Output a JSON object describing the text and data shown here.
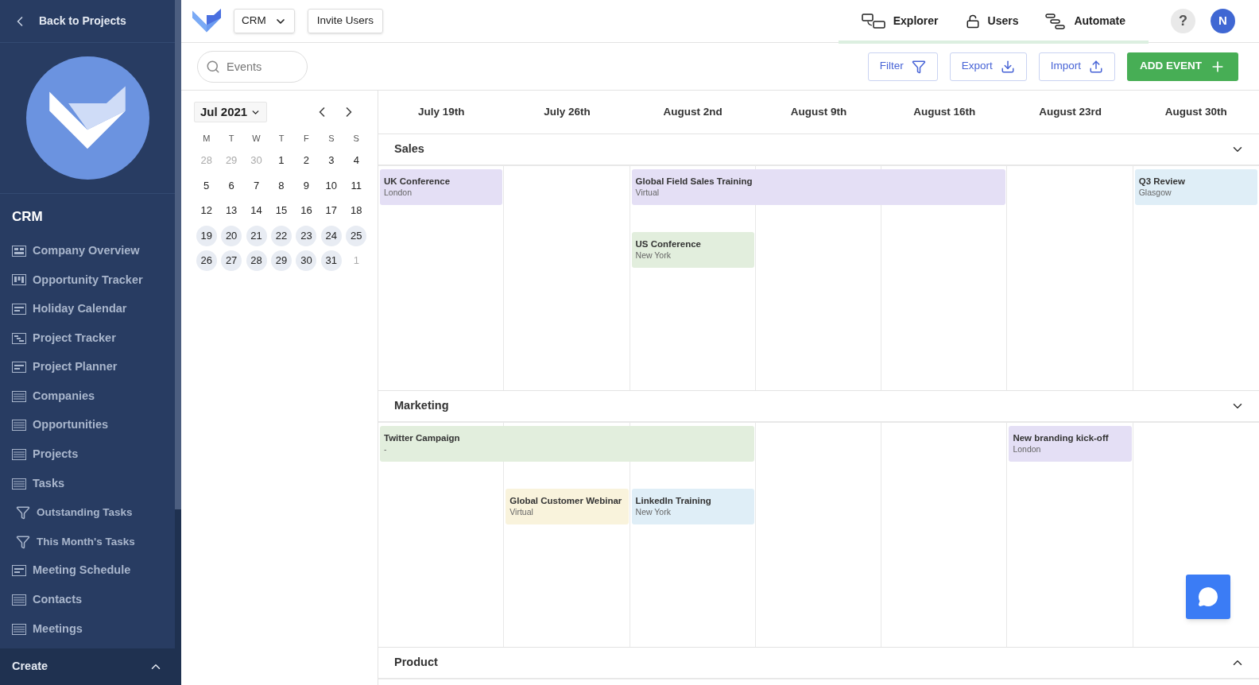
{
  "sidebar": {
    "back_label": "Back to Projects",
    "project_title": "CRM",
    "items": [
      {
        "kind": "grid",
        "label": "Company Overview"
      },
      {
        "kind": "kanban",
        "label": "Opportunity Tracker"
      },
      {
        "kind": "calendar",
        "label": "Holiday Calendar"
      },
      {
        "kind": "gantt",
        "label": "Project Tracker"
      },
      {
        "kind": "calendar",
        "label": "Project Planner"
      },
      {
        "kind": "table",
        "label": "Companies"
      },
      {
        "kind": "table",
        "label": "Opportunities"
      },
      {
        "kind": "table",
        "label": "Projects"
      },
      {
        "kind": "table",
        "label": "Tasks",
        "children": [
          {
            "kind": "filter",
            "label": "Outstanding Tasks"
          },
          {
            "kind": "filter",
            "label": "This Month's Tasks"
          }
        ]
      },
      {
        "kind": "calendar",
        "label": "Meeting Schedule"
      },
      {
        "kind": "table",
        "label": "Contacts"
      },
      {
        "kind": "table",
        "label": "Meetings"
      }
    ],
    "create_label": "Create"
  },
  "topbar": {
    "project_menu": "CRM",
    "invite_button": "Invite Users",
    "nav": [
      "Explorer",
      "Users",
      "Automate"
    ],
    "help": "?",
    "avatar": "N"
  },
  "toolbar": {
    "search_placeholder": "Events",
    "buttons": [
      {
        "kind": "filter",
        "label": "Filter"
      },
      {
        "kind": "export",
        "label": "Export"
      },
      {
        "kind": "import",
        "label": "Import"
      }
    ],
    "add_button": "ADD EVENT"
  },
  "mini_calendar": {
    "month": "Jul 2021",
    "weekdays": [
      "M",
      "T",
      "W",
      "T",
      "F",
      "S",
      "S"
    ],
    "days": [
      {
        "label": "28",
        "outside": true,
        "highlighted": false
      },
      {
        "label": "29",
        "outside": true,
        "highlighted": false
      },
      {
        "label": "30",
        "outside": true,
        "highlighted": false
      },
      {
        "label": "1",
        "outside": false,
        "highlighted": false
      },
      {
        "label": "2",
        "outside": false,
        "highlighted": false
      },
      {
        "label": "3",
        "outside": false,
        "highlighted": false
      },
      {
        "label": "4",
        "outside": false,
        "highlighted": false
      },
      {
        "label": "5",
        "outside": false,
        "highlighted": false
      },
      {
        "label": "6",
        "outside": false,
        "highlighted": false
      },
      {
        "label": "7",
        "outside": false,
        "highlighted": false
      },
      {
        "label": "8",
        "outside": false,
        "highlighted": false
      },
      {
        "label": "9",
        "outside": false,
        "highlighted": false
      },
      {
        "label": "10",
        "outside": false,
        "highlighted": false
      },
      {
        "label": "11",
        "outside": false,
        "highlighted": false
      },
      {
        "label": "12",
        "outside": false,
        "highlighted": false
      },
      {
        "label": "13",
        "outside": false,
        "highlighted": false
      },
      {
        "label": "14",
        "outside": false,
        "highlighted": false
      },
      {
        "label": "15",
        "outside": false,
        "highlighted": false
      },
      {
        "label": "16",
        "outside": false,
        "highlighted": false
      },
      {
        "label": "17",
        "outside": false,
        "highlighted": false
      },
      {
        "label": "18",
        "outside": false,
        "highlighted": false
      },
      {
        "label": "19",
        "outside": false,
        "highlighted": true
      },
      {
        "label": "20",
        "outside": false,
        "highlighted": true
      },
      {
        "label": "21",
        "outside": false,
        "highlighted": true
      },
      {
        "label": "22",
        "outside": false,
        "highlighted": true
      },
      {
        "label": "23",
        "outside": false,
        "highlighted": true
      },
      {
        "label": "24",
        "outside": false,
        "highlighted": true
      },
      {
        "label": "25",
        "outside": false,
        "highlighted": true
      },
      {
        "label": "26",
        "outside": false,
        "highlighted": true
      },
      {
        "label": "27",
        "outside": false,
        "highlighted": true
      },
      {
        "label": "28",
        "outside": false,
        "highlighted": true
      },
      {
        "label": "29",
        "outside": false,
        "highlighted": true
      },
      {
        "label": "30",
        "outside": false,
        "highlighted": true
      },
      {
        "label": "31",
        "outside": false,
        "highlighted": true
      },
      {
        "label": "1",
        "outside": true,
        "highlighted": false
      }
    ]
  },
  "timeline": {
    "columns": [
      "July 19th",
      "July 26th",
      "August 2nd",
      "August 9th",
      "August 16th",
      "August 23rd",
      "August 30th"
    ],
    "groups": [
      {
        "name": "Sales",
        "expanded": true,
        "lanes": [
          [
            {
              "kind": "event",
              "title": "UK Conference",
              "location": "London",
              "color": "#e4dff5"
            },
            {
              "kind": "empty"
            },
            {
              "kind": "event",
              "title": "Global Field Sales Training",
              "location": "Virtual",
              "color": "#e4dff5"
            },
            {
              "kind": "continued"
            },
            {
              "kind": "continued"
            },
            {
              "kind": "empty"
            },
            {
              "kind": "event",
              "title": "Q3 Review",
              "location": "Glasgow",
              "color": "#dfeef7"
            }
          ],
          [
            {
              "kind": "empty"
            },
            {
              "kind": "empty"
            },
            {
              "kind": "event",
              "title": "US Conference",
              "location": "New York",
              "color": "#e2eedd"
            },
            {
              "kind": "empty"
            },
            {
              "kind": "empty"
            },
            {
              "kind": "empty"
            },
            {
              "kind": "empty"
            }
          ]
        ]
      },
      {
        "name": "Marketing",
        "expanded": true,
        "lanes": [
          [
            {
              "kind": "event",
              "title": "Twitter Campaign",
              "location": "-",
              "color": "#e2eedd"
            },
            {
              "kind": "continued"
            },
            {
              "kind": "continued"
            },
            {
              "kind": "empty"
            },
            {
              "kind": "empty"
            },
            {
              "kind": "event",
              "title": "New branding kick-off",
              "location": "London",
              "color": "#e4dff5"
            },
            {
              "kind": "empty"
            }
          ],
          [
            {
              "kind": "empty"
            },
            {
              "kind": "event",
              "title": "Global Customer Webinar",
              "location": "Virtual",
              "color": "#f9f3dc"
            },
            {
              "kind": "event",
              "title": "LinkedIn Training",
              "location": "New York",
              "color": "#dfeef7"
            },
            {
              "kind": "empty"
            },
            {
              "kind": "empty"
            },
            {
              "kind": "empty"
            },
            {
              "kind": "empty"
            }
          ]
        ]
      },
      {
        "name": "Product",
        "expanded": false
      }
    ]
  }
}
